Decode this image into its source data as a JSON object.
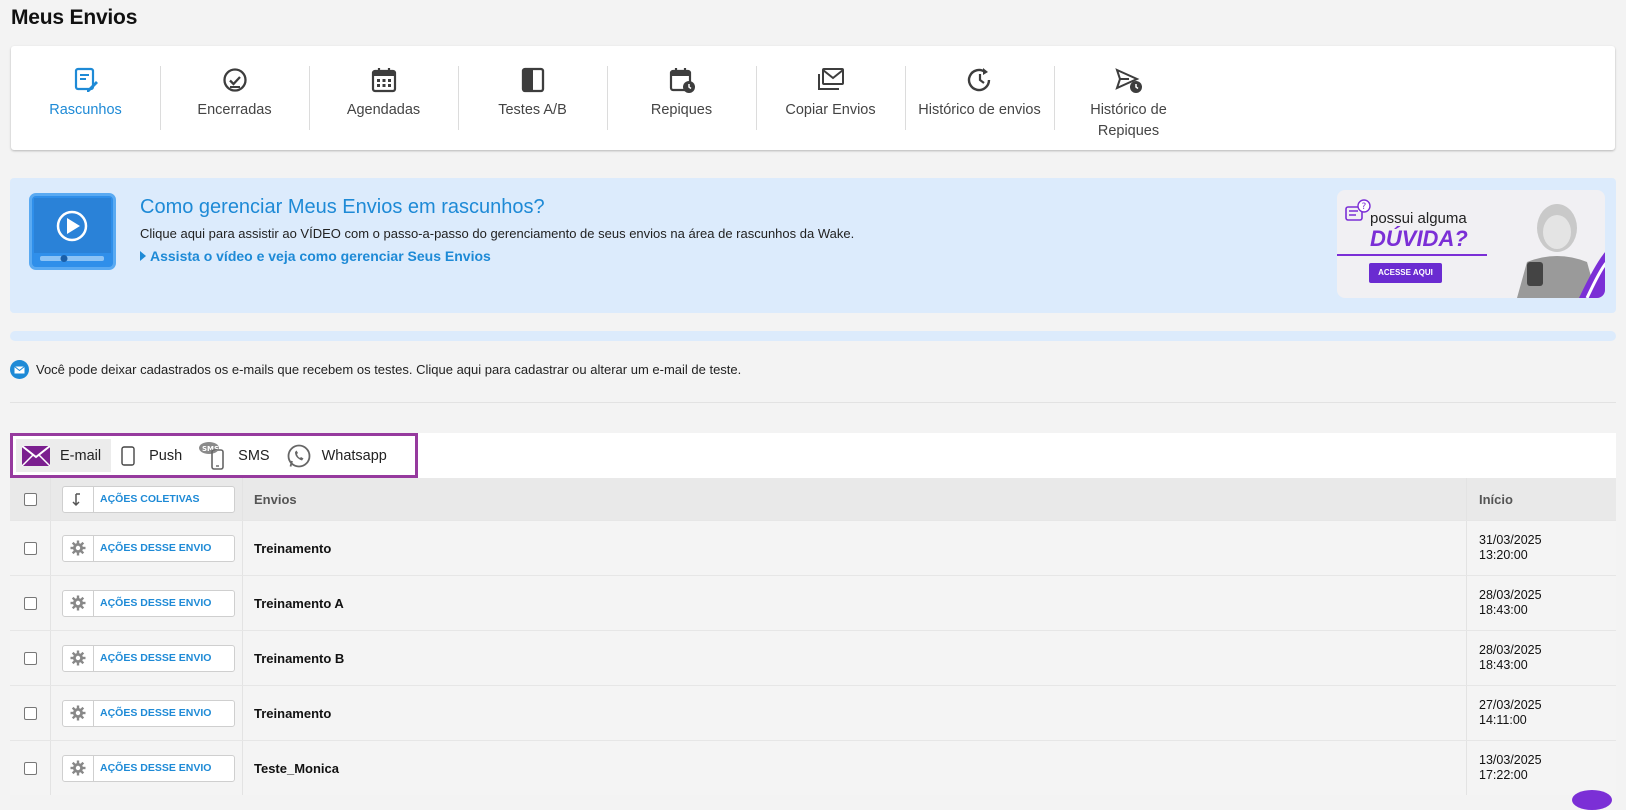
{
  "page": {
    "title": "Meus Envios"
  },
  "nav": {
    "items": [
      {
        "label": "Rascunhos",
        "icon": "draft-edit-icon",
        "active": true
      },
      {
        "label": "Encerradas",
        "icon": "check-circle-icon",
        "active": false
      },
      {
        "label": "Agendadas",
        "icon": "calendar-icon",
        "active": false
      },
      {
        "label": "Testes A/B",
        "icon": "split-square-icon",
        "active": false
      },
      {
        "label": "Repiques",
        "icon": "calendar-clock-icon",
        "active": false
      },
      {
        "label": "Copiar Envios",
        "icon": "mail-copy-icon",
        "active": false
      },
      {
        "label": "Histórico de envios",
        "icon": "history-icon",
        "active": false
      },
      {
        "label": "Histórico de Repiques",
        "icon": "send-clock-icon",
        "active": false
      }
    ]
  },
  "banner": {
    "title": "Como gerenciar Meus Envios em rascunhos?",
    "description": "Clique aqui para assistir ao VÍDEO com o passo-a-passo do gerenciamento de seus envios na área de rascunhos da Wake.",
    "link": "Assista o vídeo e veja como gerenciar Seus Envios",
    "ad": {
      "small": "possui alguma",
      "big": "DÚVIDA?",
      "button": "ACESSE AQUI"
    }
  },
  "test_note": "Você pode deixar cadastrados os e-mails que recebem os testes. Clique aqui para cadastrar ou alterar um e-mail de teste.",
  "channels": [
    {
      "label": "E-mail",
      "icon": "envelope-icon",
      "active": true
    },
    {
      "label": "Push",
      "icon": "phone-icon",
      "active": false
    },
    {
      "label": "SMS",
      "icon": "sms-phone-icon",
      "active": false
    },
    {
      "label": "Whatsapp",
      "icon": "whatsapp-icon",
      "active": false
    }
  ],
  "table": {
    "bulk_action": "AÇÕES COLETIVAS",
    "headers": {
      "envios": "Envios",
      "inicio": "Início"
    },
    "row_action": "AÇÕES DESSE ENVIO",
    "rows": [
      {
        "envio": "Treinamento",
        "date": "31/03/2025",
        "time": "13:20:00"
      },
      {
        "envio": "Treinamento A",
        "date": "28/03/2025",
        "time": "18:43:00"
      },
      {
        "envio": "Treinamento B",
        "date": "28/03/2025",
        "time": "18:43:00"
      },
      {
        "envio": "Treinamento",
        "date": "27/03/2025",
        "time": "14:11:00"
      },
      {
        "envio": "Teste_Monica",
        "date": "13/03/2025",
        "time": "17:22:00"
      }
    ]
  },
  "colors": {
    "accent": "#1e8ad6",
    "channel_border": "#963a9e",
    "brand_purple": "#7b2fd6"
  }
}
